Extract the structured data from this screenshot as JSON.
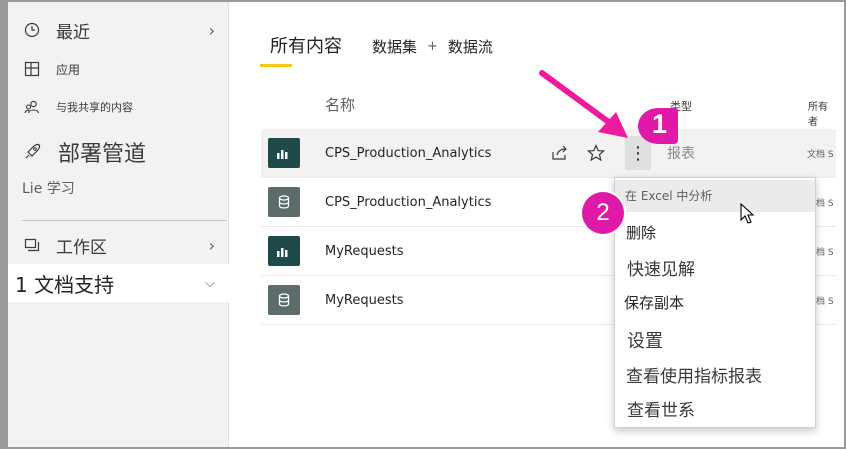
{
  "sidebar": {
    "recent_label": "最近",
    "apps_label": "应用",
    "shared_label": "与我共享的内容",
    "pipeline_label": "部署管道",
    "learn_label": "Lie 学习",
    "workspaces_label": "工作区",
    "current_workspace_label": "1 文档支持"
  },
  "tabs": {
    "all_content": "所有内容",
    "datasets": "数据集",
    "plus": "+",
    "dataflows": "数据流"
  },
  "columns": {
    "name": "名称",
    "type": "类型",
    "owner": "所有者"
  },
  "rows": [
    {
      "name": "CPS_Production_Analytics",
      "type": "报表",
      "owner": "文档 S",
      "kind": "report"
    },
    {
      "name": "CPS_Production_Analytics",
      "type": "",
      "owner": "文档 S",
      "kind": "dataset"
    },
    {
      "name": "MyRequests",
      "type": "",
      "owner": "文档 S",
      "kind": "report"
    },
    {
      "name": "MyRequests",
      "type": "",
      "owner": "文档 S",
      "kind": "dataset"
    }
  ],
  "context_menu": {
    "analyze_excel": "在 Excel 中分析",
    "delete": "删除",
    "quick_insights": "快速见解",
    "save_copy": "保存副本",
    "settings": "设置",
    "usage_metrics": "查看使用指标报表",
    "lineage": "查看世系"
  },
  "callouts": {
    "step1": "1",
    "step2": "2"
  },
  "colors": {
    "callout": "#e01aa8",
    "report_badge": "#1e4a4a",
    "dataset_badge": "#5e6b6b",
    "tab_underline": "#f2c811"
  },
  "icons": {
    "recent": "clock-icon",
    "apps": "apps-icon",
    "shared": "people-icon",
    "pipeline": "rocket-icon",
    "workspaces": "workspaces-icon",
    "share": "share-icon",
    "favorite": "star-icon",
    "more": "more-options-icon"
  }
}
